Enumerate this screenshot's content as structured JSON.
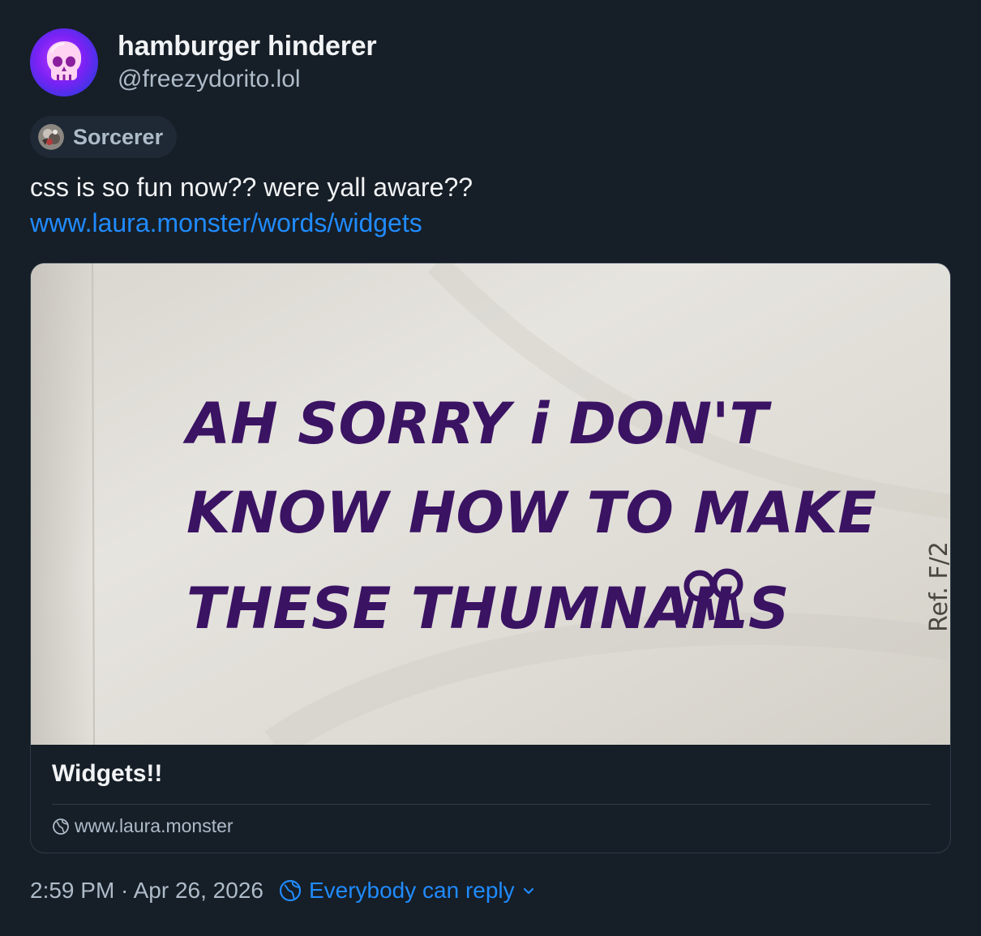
{
  "author": {
    "display_name": "hamburger hinderer",
    "handle": "@freezydorito.lol",
    "avatar_icon": "skull-icon"
  },
  "label_badge": {
    "label": "Sorcerer",
    "icon": "labeler-avatar-icon"
  },
  "post": {
    "text": "css is so fun now?? were yall aware??",
    "link_text": "www.laura.monster/words/widgets"
  },
  "link_card": {
    "thumbnail_handwriting": [
      "AH SORRY i DON'T",
      "KNOW HOW TO MAKE",
      "THESE THUMNAILS"
    ],
    "thumbnail_side_text": "Ref. F/2",
    "title": "Widgets!!",
    "domain": "www.laura.monster",
    "domain_icon": "globe-icon"
  },
  "footer": {
    "timestamp": "2:59 PM · Apr 26, 2026",
    "reply_setting": "Everybody can reply",
    "reply_icon": "globe-icon",
    "dropdown_icon": "chevron-down-icon"
  },
  "colors": {
    "background": "#161e27",
    "text_primary": "#f1f3f5",
    "text_secondary": "#aebbc9",
    "link": "#208bfe",
    "border": "#2e3b49",
    "handwriting_ink": "#3a1363"
  }
}
